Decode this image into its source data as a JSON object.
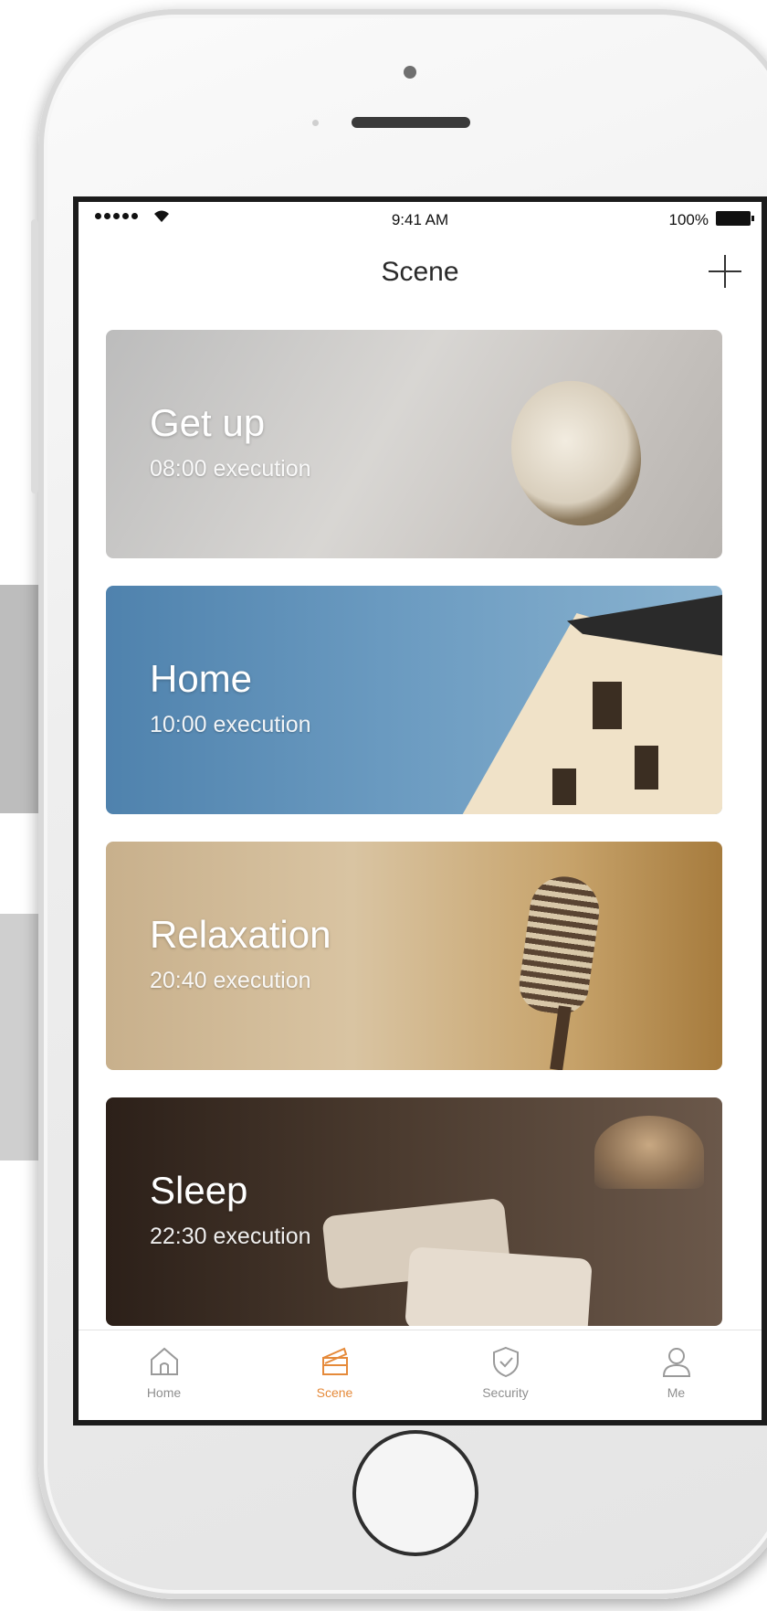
{
  "status_bar": {
    "time": "9:41 AM",
    "battery": "100%"
  },
  "nav": {
    "title": "Scene"
  },
  "scenes": [
    {
      "name": "Get up",
      "time": "08:00 execution",
      "image": "pocket-watch"
    },
    {
      "name": "Home",
      "time": "10:00 execution",
      "image": "house"
    },
    {
      "name": "Relaxation",
      "time": "20:40 execution",
      "image": "microphone"
    },
    {
      "name": "Sleep",
      "time": "22:30 execution",
      "image": "bedroom"
    }
  ],
  "tabs": [
    {
      "label": "Home",
      "icon": "home-icon",
      "active": false
    },
    {
      "label": "Scene",
      "icon": "scene-icon",
      "active": true
    },
    {
      "label": "Security",
      "icon": "shield-icon",
      "active": false
    },
    {
      "label": "Me",
      "icon": "user-icon",
      "active": false
    }
  ],
  "colors": {
    "accent": "#e58a3a",
    "inactive_tab": "#8f8f8f"
  }
}
